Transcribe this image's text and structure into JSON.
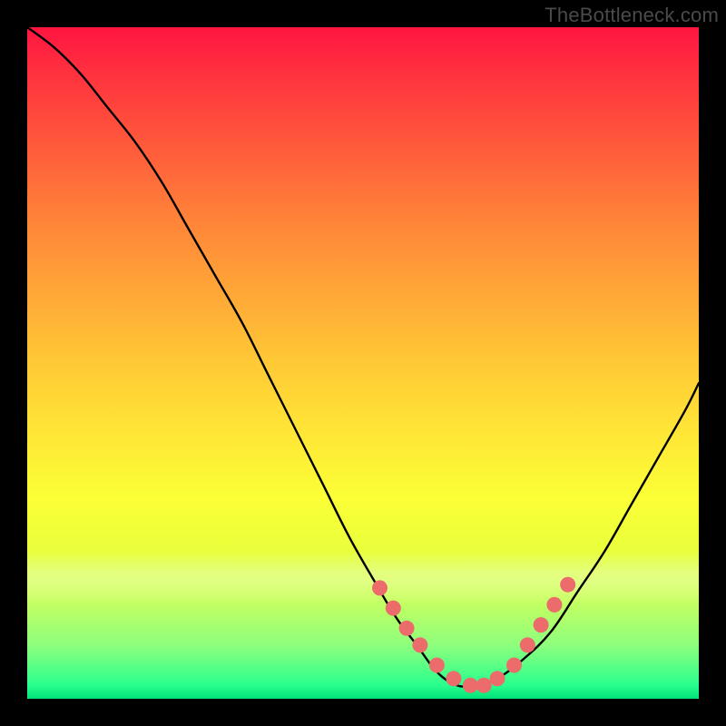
{
  "watermark": "TheBottleneck.com",
  "colors": {
    "curve": "#000000",
    "dots": "#ec6b6b",
    "dot_stroke": "#b84d4d"
  },
  "chart_data": {
    "type": "line",
    "title": "",
    "xlabel": "",
    "ylabel": "",
    "xlim": [
      0,
      100
    ],
    "ylim": [
      0,
      100
    ],
    "grid": false,
    "legend": false,
    "series": [
      {
        "name": "bottleneck-curve",
        "x": [
          0,
          4,
          8,
          12,
          16,
          20,
          24,
          28,
          32,
          36,
          40,
          44,
          48,
          52,
          55,
          58,
          61,
          64,
          67,
          70,
          74,
          78,
          82,
          86,
          90,
          94,
          98,
          100
        ],
        "y": [
          100,
          97,
          93,
          88,
          83,
          77,
          70,
          63,
          56,
          48,
          40,
          32,
          24,
          17,
          12,
          8,
          4,
          2,
          2,
          3,
          6,
          10,
          16,
          22,
          29,
          36,
          43,
          47
        ]
      }
    ],
    "markers": {
      "name": "highlighted-points",
      "x": [
        52.5,
        54.5,
        56.5,
        58.5,
        61,
        63.5,
        66,
        68,
        70,
        72.5,
        74.5,
        76.5,
        78.5,
        80.5
      ],
      "y": [
        16.5,
        13.5,
        10.5,
        8,
        5,
        3,
        2,
        2,
        3,
        5,
        8,
        11,
        14,
        17
      ]
    }
  }
}
